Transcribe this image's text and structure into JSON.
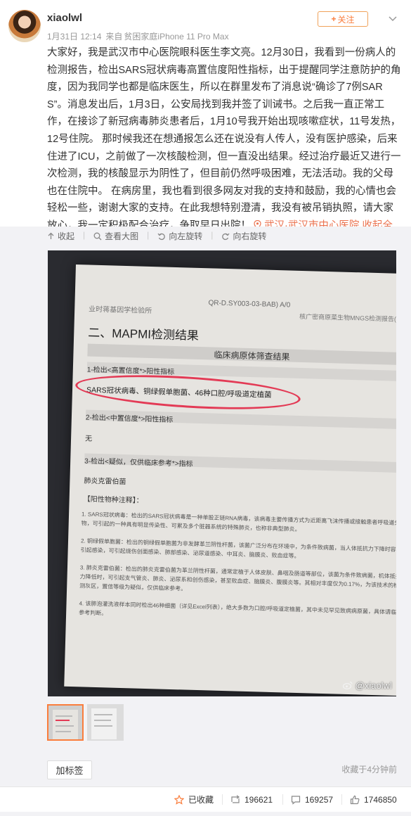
{
  "user": {
    "name": "xiaolwl"
  },
  "meta": {
    "date": "1月31日 12:14",
    "source_prefix": "来自",
    "source_device": "贫困家庭iPhone 11 Pro Max"
  },
  "follow": {
    "label": "关注",
    "plus": "+"
  },
  "post": {
    "text": "大家好，我是武汉市中心医院眼科医生李文亮。12月30日，我看到一份病人的检测报告，检出SARS冠状病毒高置信度阳性指标，出于提醒同学注意防护的角度，因为我同学也都是临床医生，所以在群里发布了消息说“确诊了7例SARS”。消息发出后，1月3日，公安局找到我并签了训诫书。之后我一直正常工作，在接诊了新冠病毒肺炎患者后，1月10号我开始出现咳嗽症状，11号发热，12号住院。 那时候我还在想通报怎么还在说没有人传人，没有医护感染，后来住进了ICU，之前做了一次核酸检测，但一直没出结果。经过治疗最近又进行一次检测，我的核酸显示为阴性了，但目前仍然呼吸困难，无法活动。我的父母也在住院中。 在病房里，我也看到很多网友对我的支持和鼓励，我的心情也会轻松一些，谢谢大家的支持。在此我想特别澄清，我没有被吊销执照，请大家放心，我一定积极配合治疗，争取早日出院！",
    "location": "武汉·武汉市中心医院",
    "collapse": "收起全文"
  },
  "toolbar": {
    "collapse": "收起",
    "view_large": "查看大图",
    "rotate_left": "向左旋转",
    "rotate_right": "向右旋转"
  },
  "photo": {
    "header_left": "业时蒋基因学检验所",
    "header_mid": "QR-D.SY003-03-BAB) A/0",
    "header_right": "核广密商原菜生物MNGS检测报告(MAPMI v1.1)",
    "section_title": "二、MAPMI检测结果",
    "band_title": "临床病原体筛查结果",
    "row1": "1-检出<高置信度*>阳性指标",
    "row1_detail": "SARS冠状病毒、铜绿假单胞菌、46种口腔/呼吸道定植菌",
    "row2": "2-检出<中置信度*>阳性指标",
    "row2_value": "无",
    "row3": "3-检出<疑似，仅供临床参考*>指标",
    "row3_value": "肺炎克雷伯菌",
    "notes_title": "【阳性物种注释】：",
    "note1": "1. SARS冠状病毒：检出的SARS冠状病毒是一种单股正链RNA病毒，该病毒主要传播方式为近距离飞沫传播或接触患者呼吸道分泌物，可引起的一种具有明显传染性、可累及多个脏器系统的特殊肺炎，也称非典型肺炎。",
    "note2": "2. 铜绿假单胞菌：检出的铜绿假单胞菌为非发酵革兰阴性杆菌，该菌广泛分布在环境中，为条件致病菌，当人体抵抗力下降时容易引起感染，可引起烧伤创面感染、肺部感染、泌尿道感染、中耳炎、脑膜炎、败血症等。",
    "note3": "3. 肺炎克雷伯菌：检出的肺炎克雷伯菌为革兰阴性杆菌，通常定植于人体皮肤、鼻咽及肠道等部位，该菌为条件致病菌，机体抵抗力降低时，可引起支气管炎、肺炎、泌尿系和创伤感染，甚至败血症、脑膜炎、腹膜炎等。其相对丰度仅为0.17%，为该技术的检测灰区，置信等级为疑似，仅供临床参考。",
    "note4": "4. 该肺泡灌洗液样本同时检出46种细菌（详见Excel列表），绝大多数为口腔/呼吸道定植菌，其中未见罕见致病病原菌，具体请临床参考判断。",
    "watermark": "@xiaolwl"
  },
  "footer": {
    "add_tag": "加标签",
    "favorited_time": "收藏于4分钟前"
  },
  "actions": {
    "favorited": "已收藏",
    "reposts": "196621",
    "comments": "169257",
    "likes": "1746850"
  },
  "colors": {
    "accent": "#fa7d3c",
    "link": "#eb7350",
    "circle": "#e33a55"
  }
}
